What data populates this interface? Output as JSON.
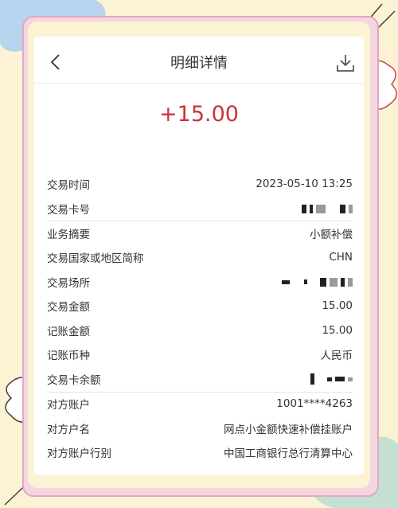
{
  "header": {
    "title": "明细详情"
  },
  "amount": "+15.00",
  "rows": [
    {
      "label": "交易时间",
      "value": "2023-05-10 13:25"
    },
    {
      "label": "交易卡号",
      "value": ""
    },
    {
      "label": "业务摘要",
      "value": "小额补偿"
    },
    {
      "label": "交易国家或地区简称",
      "value": "CHN"
    },
    {
      "label": "交易场所",
      "value": ""
    },
    {
      "label": "交易金额",
      "value": "15.00"
    },
    {
      "label": "记账金额",
      "value": "15.00"
    },
    {
      "label": "记账币种",
      "value": "人民币"
    },
    {
      "label": "交易卡余额",
      "value": ""
    },
    {
      "label": "对方账户",
      "value": "1001****4263"
    },
    {
      "label": "对方户名",
      "value": "网点小金额快速补偿挂账户"
    },
    {
      "label": "对方账户行别",
      "value": "中国工商银行总行清算中心"
    }
  ],
  "colors": {
    "amount": "#c9333a",
    "background": "#fbf3d4",
    "frame": "#f4d6e0"
  },
  "icons": {
    "back": "chevron-left-icon",
    "download": "download-icon"
  }
}
